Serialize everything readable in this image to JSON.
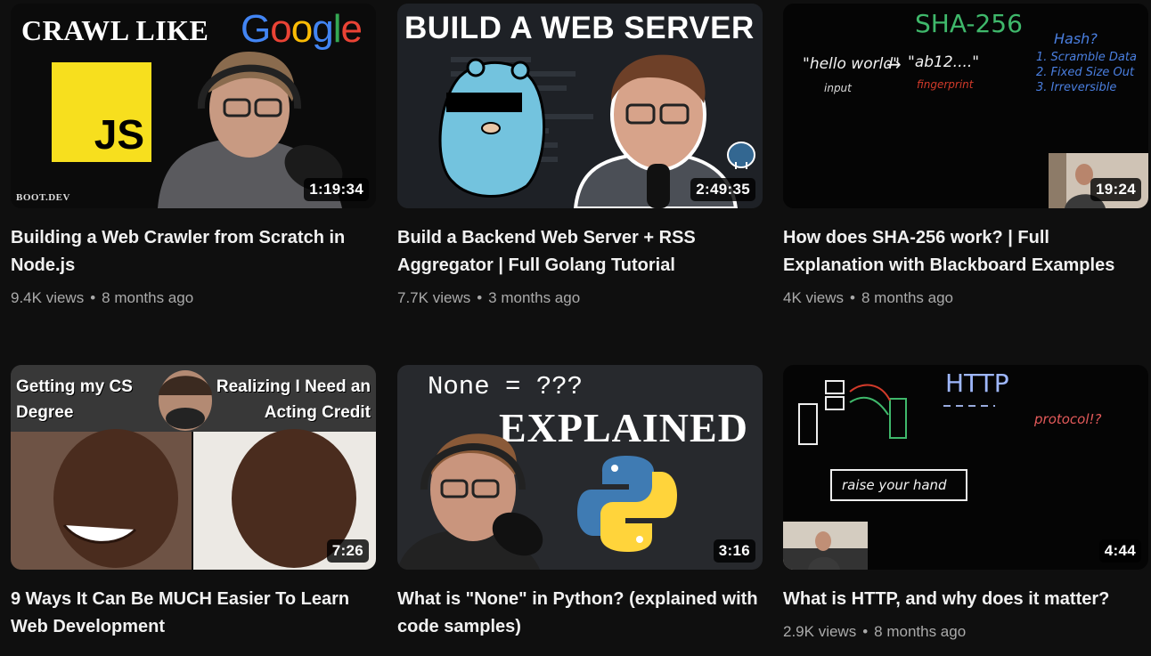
{
  "videos": [
    {
      "title": "Building a Web Crawler from Scratch in Node.js",
      "views": "9.4K views",
      "age": "8 months ago",
      "duration": "1:19:34",
      "thumb": {
        "headline": "CRAWL LIKE",
        "brand": "Google",
        "badge": "JS",
        "watermark": "BOOT.DEV"
      }
    },
    {
      "title": "Build a Backend Web Server + RSS Aggregator | Full Golang Tutorial",
      "views": "7.7K views",
      "age": "3 months ago",
      "duration": "2:49:35",
      "thumb": {
        "headline": "BUILD A WEB SERVER"
      }
    },
    {
      "title": "How does SHA-256 work? | Full Explanation with Blackboard Examples",
      "views": "4K views",
      "age": "8 months ago",
      "duration": "19:24",
      "thumb": {
        "heading": "SHA-256",
        "input": "\"hello world\"",
        "arrow": "→",
        "output": "\"ab12....\"",
        "input_label": "input",
        "output_label": "fingerprint",
        "list_title": "Hash?",
        "list": [
          "1. Scramble Data",
          "2. Fixed Size Out",
          "3. Irreversible"
        ]
      }
    },
    {
      "title": "9 Ways It Can Be MUCH Easier To Learn Web Development",
      "views": "",
      "age": "",
      "duration": "7:26",
      "thumb": {
        "left_caption": "Getting my CS Degree",
        "right_caption": "Realizing I Need an Acting Credit"
      }
    },
    {
      "title": "What is \"None\" in Python? (explained with code samples)",
      "views": "",
      "age": "",
      "duration": "3:16",
      "thumb": {
        "code": "None = ???",
        "headline": "EXPLAINED"
      }
    },
    {
      "title": "What is HTTP, and why does it matter?",
      "views": "2.9K views",
      "age": "8 months ago",
      "duration": "4:44",
      "thumb": {
        "heading": "HTTP",
        "scribble": "protocol!?",
        "box_text": "raise your hand"
      }
    }
  ],
  "separator": "•",
  "colors": {
    "background": "#0f0f0f",
    "title": "#f1f1f1",
    "meta": "#aaaaaa",
    "js_yellow": "#f7df1e"
  }
}
